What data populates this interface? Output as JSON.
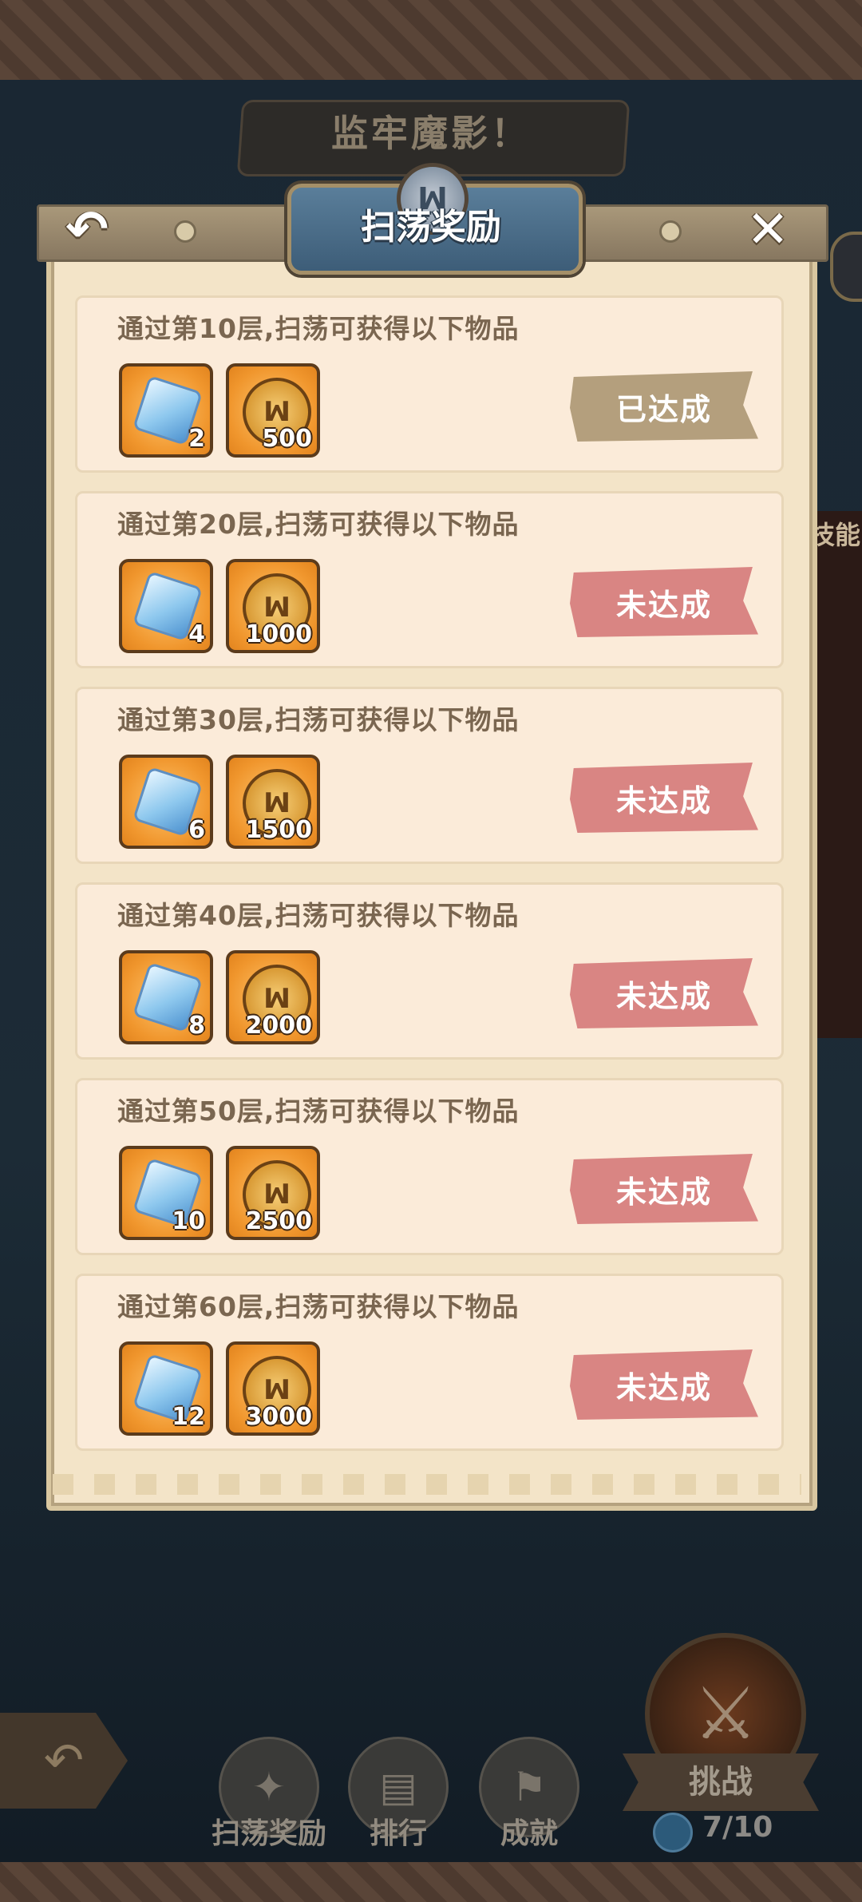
{
  "background": {
    "stage_title": "监牢魔影！",
    "side_panel_text": "技能"
  },
  "dialog": {
    "title": "扫荡奖励",
    "back_icon": "back-arrow-icon",
    "close_icon": "close-icon",
    "status_done": "已达成",
    "status_not_done": "未达成",
    "rewards": [
      {
        "title": "通过第10层,扫荡可获得以下物品",
        "gem_qty": "2",
        "coin_qty": "500",
        "status": "已达成",
        "achieved": true
      },
      {
        "title": "通过第20层,扫荡可获得以下物品",
        "gem_qty": "4",
        "coin_qty": "1000",
        "status": "未达成",
        "achieved": false
      },
      {
        "title": "通过第30层,扫荡可获得以下物品",
        "gem_qty": "6",
        "coin_qty": "1500",
        "status": "未达成",
        "achieved": false
      },
      {
        "title": "通过第40层,扫荡可获得以下物品",
        "gem_qty": "8",
        "coin_qty": "2000",
        "status": "未达成",
        "achieved": false
      },
      {
        "title": "通过第50层,扫荡可获得以下物品",
        "gem_qty": "10",
        "coin_qty": "2500",
        "status": "未达成",
        "achieved": false
      },
      {
        "title": "通过第60层,扫荡可获得以下物品",
        "gem_qty": "12",
        "coin_qty": "3000",
        "status": "未达成",
        "achieved": false
      }
    ]
  },
  "bottom_nav": {
    "sweep_rewards": "扫荡奖励",
    "ranking": "排行",
    "achievements": "成就",
    "challenge": "挑战",
    "energy": "7/10"
  },
  "colors": {
    "status_done_bg": "#b49f7d",
    "status_not_done_bg": "#d98583",
    "title_plate": "#4a6c88",
    "card_bg": "#fbebd9"
  }
}
